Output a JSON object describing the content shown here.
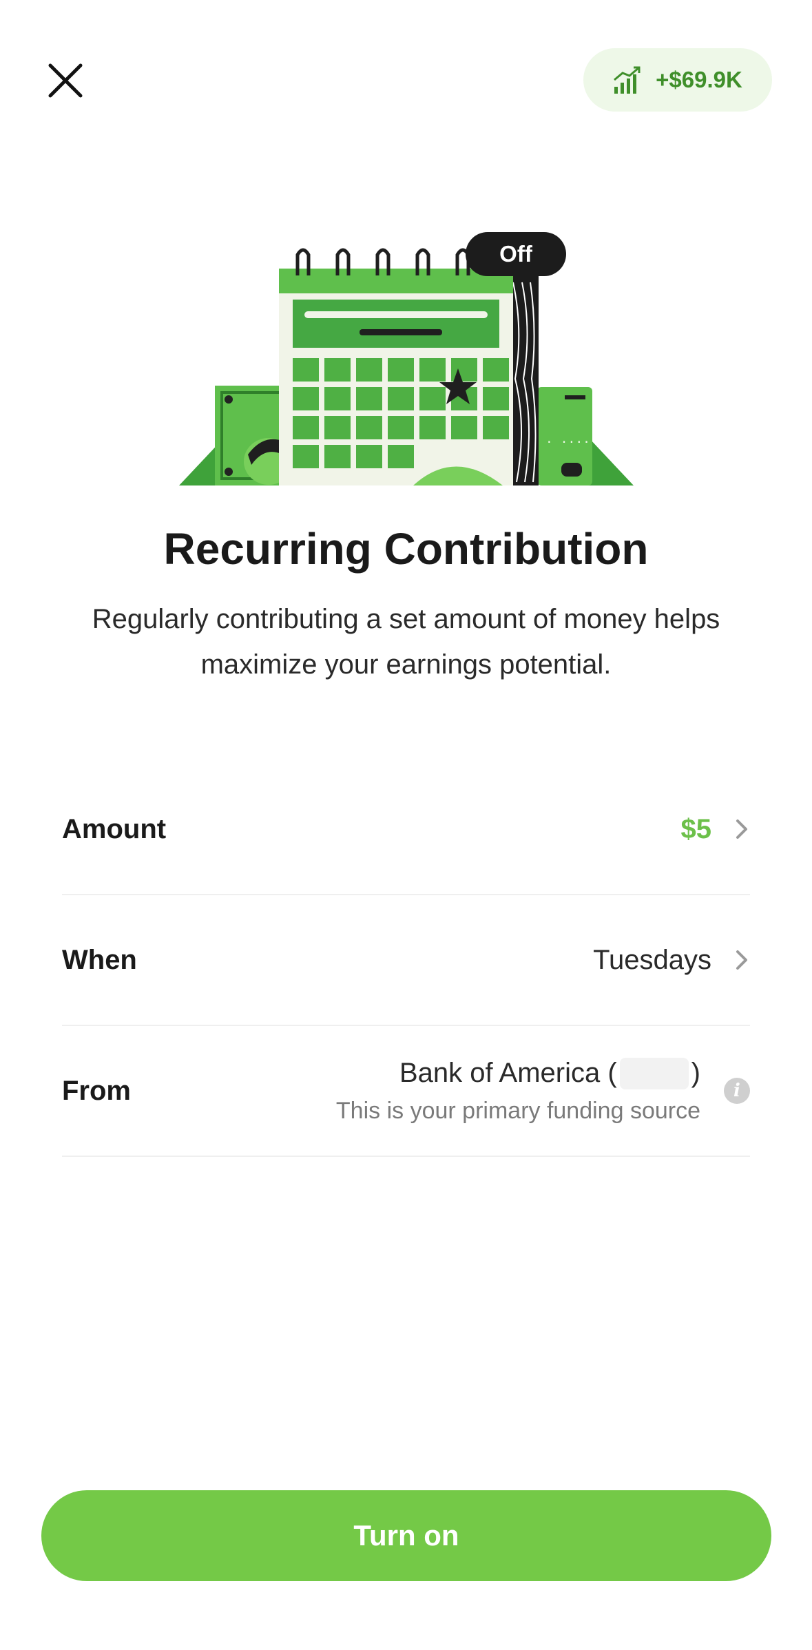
{
  "header": {
    "close_icon": "close-icon",
    "earnings": {
      "icon": "signal-bars-icon",
      "value": "+$69.9K"
    }
  },
  "illustration": {
    "name": "calendar-illustration",
    "status_label": "Off"
  },
  "title": "Recurring Contribution",
  "subtitle": "Regularly contributing a set amount of money helps maximize your earnings potential.",
  "settings": {
    "amount": {
      "label": "Amount",
      "value": "$5"
    },
    "when": {
      "label": "When",
      "value": "Tuesdays"
    },
    "from": {
      "label": "From",
      "bank_name": "Bank of America (",
      "bank_suffix": ")",
      "note": "This is your primary funding source"
    }
  },
  "cta_label": "Turn on",
  "colors": {
    "accent_green": "#74c947",
    "amount_green": "#6cc04a",
    "pill_bg": "#eef8e8",
    "pill_text": "#3f8f2a"
  }
}
